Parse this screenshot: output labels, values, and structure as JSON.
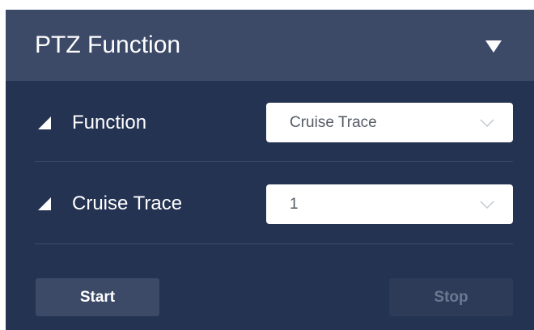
{
  "panel": {
    "title": "PTZ Function",
    "collapse_icon": "triangle-down-icon"
  },
  "rows": [
    {
      "label": "Function",
      "icon": "corner-triangle-icon",
      "select": {
        "value": "Cruise Trace",
        "caret_icon": "chevron-down-icon"
      }
    },
    {
      "label": "Cruise Trace",
      "icon": "corner-triangle-icon",
      "select": {
        "value": "1",
        "caret_icon": "chevron-down-icon"
      }
    }
  ],
  "buttons": {
    "start": "Start",
    "stop": "Stop"
  },
  "colors": {
    "panel_bg": "#243352",
    "header_bg": "#3c4a68",
    "text": "#ffffff",
    "select_bg": "#ffffff",
    "disabled_text": "#6c7790"
  }
}
